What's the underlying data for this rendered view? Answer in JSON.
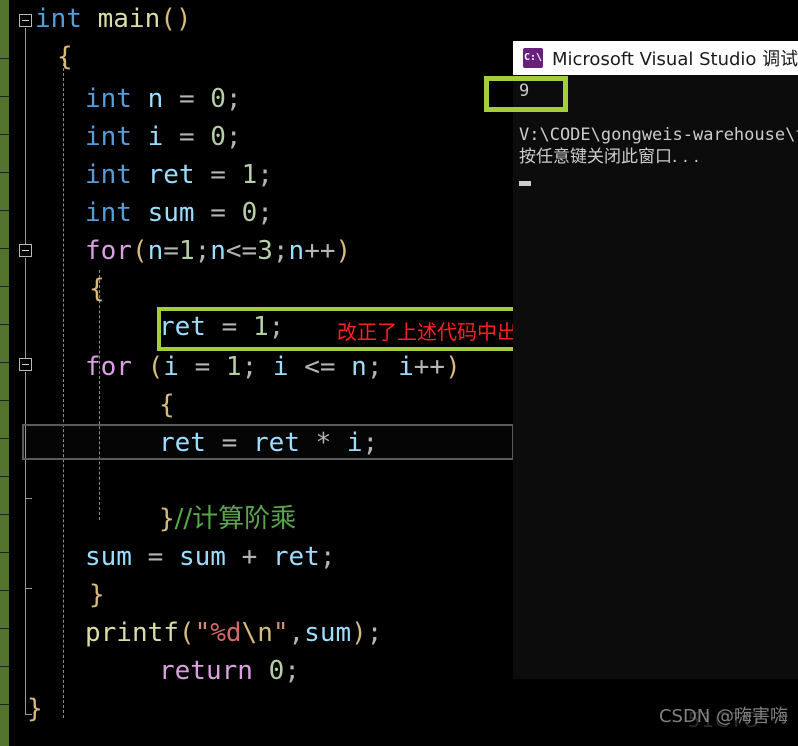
{
  "editor": {
    "background_color": "#000000",
    "change_bar_color": "#53742F",
    "lines": [
      {
        "indent": 0,
        "text": "int main()"
      },
      {
        "indent": 0,
        "text": "{"
      },
      {
        "indent": 1,
        "text": "int n = 0;"
      },
      {
        "indent": 1,
        "text": "int i = 0;"
      },
      {
        "indent": 1,
        "text": "int ret = 1;"
      },
      {
        "indent": 1,
        "text": "int sum = 0;"
      },
      {
        "indent": 1,
        "text": "for(n=1;n<=3;n++)"
      },
      {
        "indent": 1,
        "text": "{"
      },
      {
        "indent": 2,
        "text": "ret = 1;"
      },
      {
        "indent": 1,
        "text": "for (i = 1; i <= n; i++)"
      },
      {
        "indent": 2,
        "text": "{"
      },
      {
        "indent": 2,
        "text": "ret = ret * i;"
      },
      {
        "indent": 0,
        "text": ""
      },
      {
        "indent": 2,
        "text": "}//计算阶乘"
      },
      {
        "indent": 1,
        "text": "sum = sum + ret;"
      },
      {
        "indent": 1,
        "text": "}"
      },
      {
        "indent": 1,
        "text": "printf(\"%d\\n\",sum);"
      },
      {
        "indent": 2,
        "text": "return 0;"
      },
      {
        "indent": 0,
        "text": "}"
      }
    ]
  },
  "annotation": {
    "label": "改正了上述代码中出现的问题",
    "box_color": "#A4CE39",
    "text_color": "#FF2020",
    "target_code": "ret = 1;"
  },
  "console": {
    "title": "Microsoft Visual Studio 调试控制台",
    "icon_label": "C:\\",
    "icon_color": "#68217A",
    "output_value": "9",
    "path_line": "V:\\CODE\\gongweis-warehouse\\t",
    "prompt_line": "按任意键关闭此窗口. . .",
    "highlight_color": "#A4CE39"
  },
  "watermark": {
    "text": "CSDN @嗨害嗨",
    "ghost_text": "51CTO"
  }
}
